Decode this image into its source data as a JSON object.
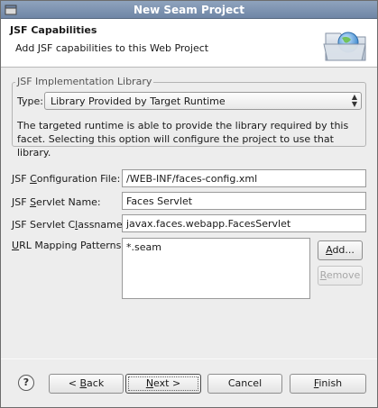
{
  "window": {
    "title": "New Seam Project"
  },
  "header": {
    "title": "JSF Capabilities",
    "description": "Add JSF capabilities to this Web Project",
    "banner_icon": "folder-globe-icon"
  },
  "implementation": {
    "legend": "JSF Implementation Library",
    "type_label": "Type:",
    "type_value": "Library Provided by Target Runtime",
    "description": "The targeted runtime is able to provide the library required by this facet. Selecting this option will configure the project to use that library."
  },
  "config_file": {
    "label_pre": "JSF ",
    "label_u": "C",
    "label_post": "onfiguration File:",
    "value": "/WEB-INF/faces-config.xml"
  },
  "servlet_name": {
    "label_pre": "JSF ",
    "label_u": "S",
    "label_post": "ervlet Name:",
    "value": "Faces Servlet"
  },
  "servlet_class": {
    "label_pre": "JSF Servlet C",
    "label_u": "l",
    "label_post": "assname:",
    "value": "javax.faces.webapp.FacesServlet"
  },
  "url_patterns": {
    "label_u": "U",
    "label_post": "RL Mapping Patterns:",
    "items": [
      "*.seam"
    ],
    "add_pre": "",
    "add_u": "A",
    "add_post": "dd...",
    "remove_pre": "",
    "remove_u": "R",
    "remove_post": "emove"
  },
  "footer": {
    "help_icon": "help-icon",
    "back_pre": "< ",
    "back_u": "B",
    "back_post": "ack",
    "next_pre": "",
    "next_u": "N",
    "next_post": "ext >",
    "cancel": "Cancel",
    "finish_pre": "",
    "finish_u": "F",
    "finish_post": "inish"
  }
}
